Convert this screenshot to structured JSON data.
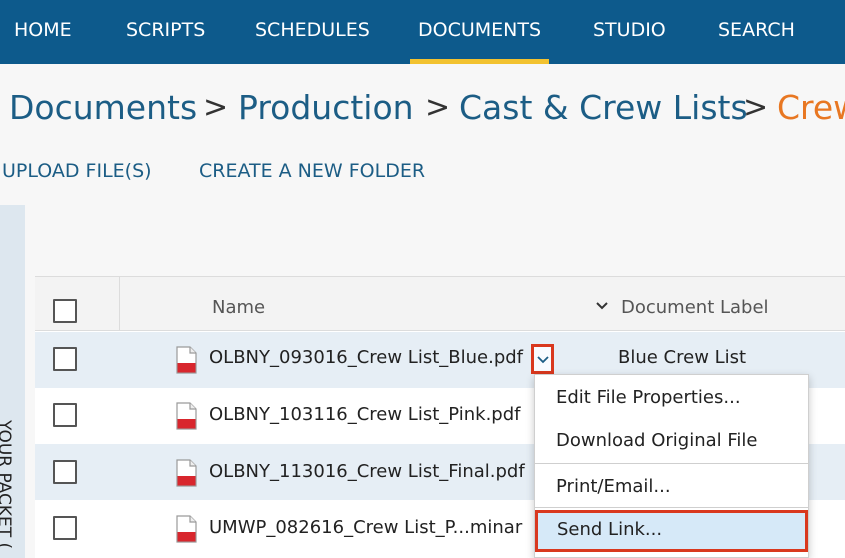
{
  "nav": {
    "home": "HOME",
    "scripts": "SCRIPTS",
    "schedules": "SCHEDULES",
    "documents": "DOCUMENTS",
    "studio": "STUDIO",
    "search": "SEARCH"
  },
  "breadcrumb": {
    "items": [
      "Documents",
      "Production",
      "Cast & Crew Lists",
      "Crew"
    ],
    "separator": ">"
  },
  "actions": {
    "upload": "UPLOAD FILE(S)",
    "new_folder": "CREATE A NEW FOLDER"
  },
  "side_panel": {
    "label": "YOUR PACKET ("
  },
  "table": {
    "columns": {
      "name": "Name",
      "label": "Document Label"
    },
    "rows": [
      {
        "name": "OLBNY_093016_Crew List_Blue.pdf",
        "label": "Blue Crew List"
      },
      {
        "name": "OLBNY_103116_Crew List_Pink.pdf",
        "label": ""
      },
      {
        "name": "OLBNY_113016_Crew List_Final.pdf",
        "label": ""
      },
      {
        "name": "UMWP_082616_Crew List_P...minar",
        "label": ""
      }
    ]
  },
  "context_menu": {
    "items": [
      "Edit File Properties...",
      "Download Original File",
      "Print/Email...",
      "Send Link..."
    ]
  },
  "colors": {
    "nav_bg": "#0d5a8c",
    "nav_active_underline": "#f2c230",
    "link": "#1c5d85",
    "breadcrumb_current": "#e87722",
    "highlight_border": "#d9381e",
    "row_alt": "#e6eef5"
  },
  "icons": [
    "pdf-file-icon",
    "chevron-down-icon",
    "sort-chevron-icon"
  ]
}
